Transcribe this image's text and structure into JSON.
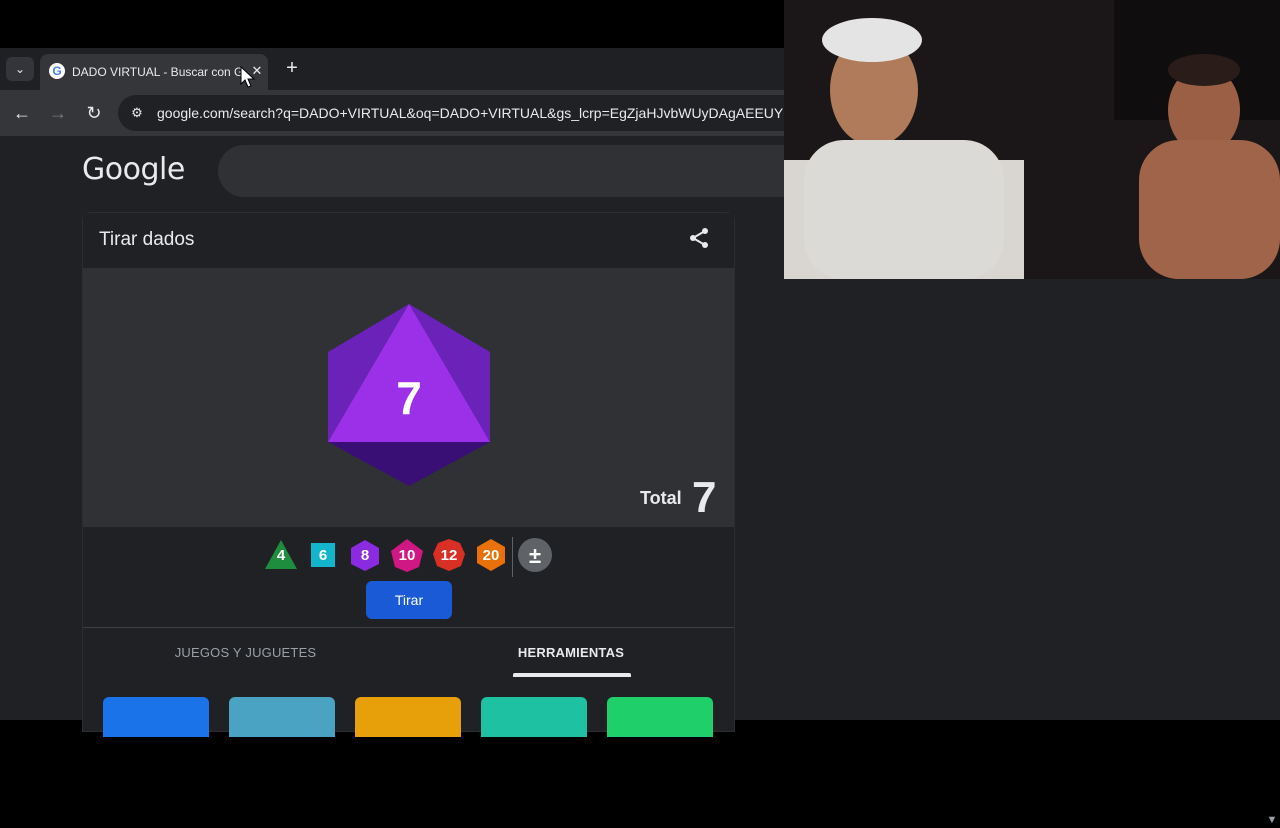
{
  "browser": {
    "tab_menu_icon": "chevron-down-icon",
    "tab_title": "DADO VIRTUAL - Buscar con Google",
    "tab_close": "✕",
    "new_tab": "+",
    "url": "google.com/search?q=DADO+VIRTUAL&oq=DADO+VIRTUAL&gs_lcrp=EgZjaHJvbWUyDAgAEEUYORi"
  },
  "search": {
    "logo": "Google",
    "query": ""
  },
  "dice_widget": {
    "title": "Tirar dados",
    "result_value": "7",
    "total_label": "Total",
    "total_value": "7",
    "die_buttons": [
      {
        "label": "4",
        "color": "#1e8e3e"
      },
      {
        "label": "6",
        "color": "#12b5cb"
      },
      {
        "label": "8",
        "color": "#8a2be2"
      },
      {
        "label": "10",
        "color": "#d01884"
      },
      {
        "label": "12",
        "color": "#d93025"
      },
      {
        "label": "20",
        "color": "#e8710a"
      },
      {
        "label": "±",
        "color": "#5f6368"
      }
    ],
    "roll_label": "Tirar",
    "accent_color": "#8e24d8"
  },
  "related_tabs": {
    "games": "JUEGOS Y JUGUETES",
    "tools": "HERRAMIENTAS",
    "active": "tools"
  }
}
